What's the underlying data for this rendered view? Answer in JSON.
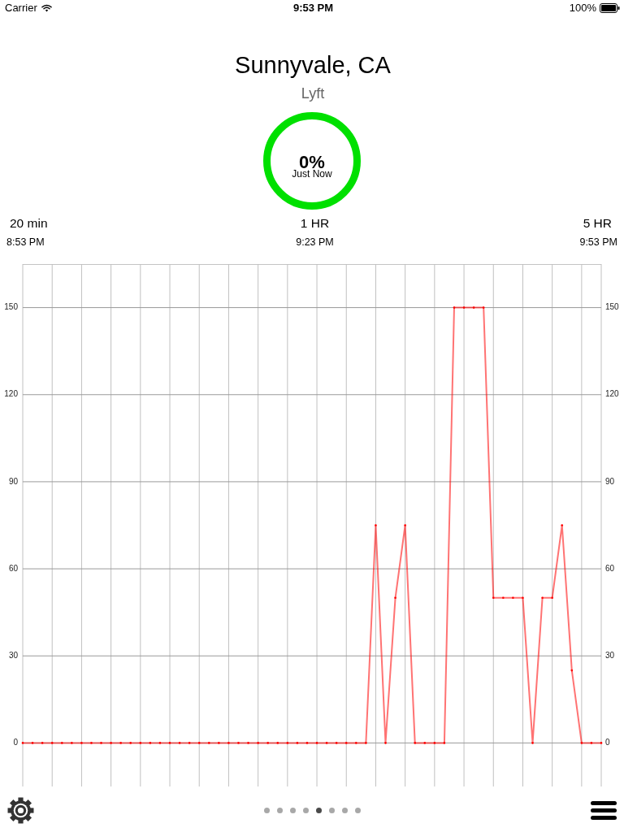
{
  "status_bar": {
    "carrier": "Carrier",
    "time": "9:53 PM",
    "battery": "100%"
  },
  "header": {
    "title": "Sunnyvale, CA",
    "subtitle": "Lyft"
  },
  "gauge": {
    "value": "0%",
    "caption": "Just Now"
  },
  "time_labels": [
    {
      "label": "20 min",
      "time": "8:53 PM"
    },
    {
      "label": "1 HR",
      "time": "9:23 PM"
    },
    {
      "label": "5 HR",
      "time": "9:53 PM"
    }
  ],
  "chart": {
    "chart_data": {
      "type": "line",
      "grid": true,
      "ylim": [
        -15,
        165
      ],
      "yticks": [
        0,
        30,
        60,
        90,
        120,
        150
      ],
      "annotations": [
        "0",
        "30",
        "60",
        "90",
        "120",
        "150"
      ],
      "series": [
        {
          "color": "#ff0000",
          "values": [
            0,
            0,
            0,
            0,
            0,
            0,
            0,
            0,
            0,
            0,
            0,
            0,
            0,
            0,
            0,
            0,
            0,
            0,
            0,
            0,
            0,
            0,
            0,
            0,
            0,
            0,
            0,
            0,
            0,
            0,
            0,
            0,
            0,
            0,
            0,
            0,
            75,
            0,
            50,
            75,
            0,
            0,
            0,
            0,
            150,
            150,
            150,
            150,
            50,
            50,
            50,
            50,
            0,
            50,
            50,
            75,
            25,
            0,
            0,
            0
          ]
        }
      ]
    }
  },
  "pager": {
    "pages": [
      {
        "selected": false
      },
      {
        "selected": false
      },
      {
        "selected": false
      },
      {
        "selected": false
      },
      {
        "selected": true
      },
      {
        "selected": false
      },
      {
        "selected": false
      },
      {
        "selected": false
      }
    ]
  }
}
